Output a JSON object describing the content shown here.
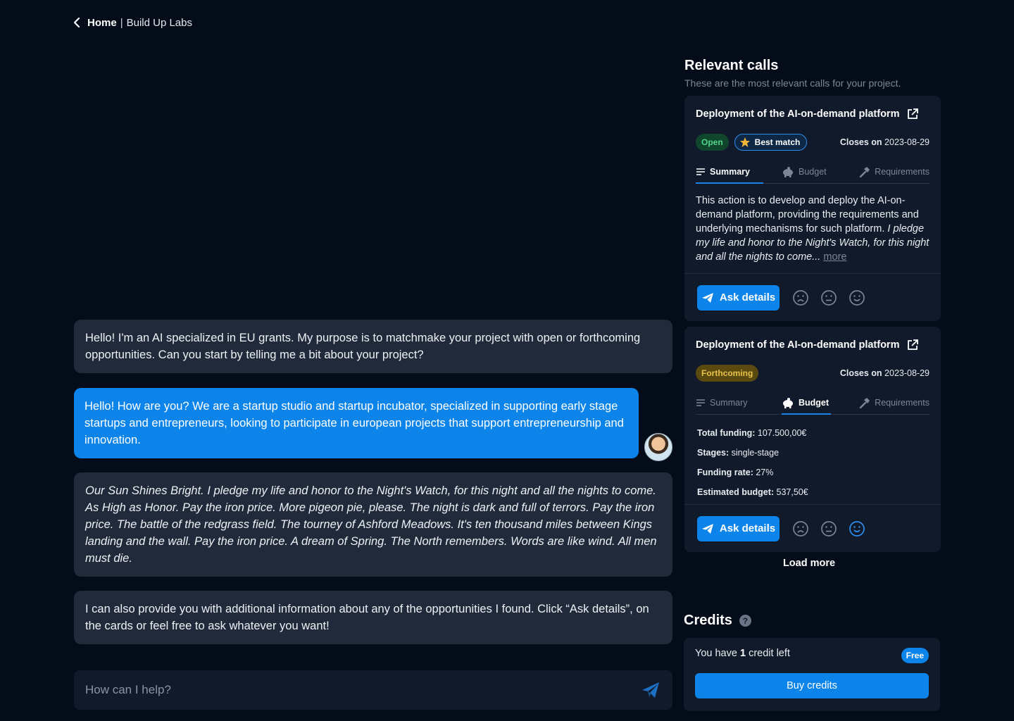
{
  "breadcrumb": {
    "home": "Home",
    "separator": "|",
    "current": "Build Up Labs"
  },
  "chat": {
    "messages": [
      {
        "role": "assistant",
        "text": "Hello! I'm an AI specialized in EU grants. My purpose is to matchmake your project with open or forthcoming opportunities. Can you start by telling me a bit about your project?"
      },
      {
        "role": "user",
        "text": "Hello! How are you? We are a startup studio and startup incubator, specialized in supporting early stage startups and entrepreneurs, looking to participate in european projects that support entrepreneurship and innovation."
      },
      {
        "role": "assistant",
        "text": "Our Sun Shines Bright. I pledge my life and honor to the Night's Watch, for this night and all the nights to come. As High as Honor. Pay the iron price. More pigeon pie, please. The night is dark and full of terrors. Pay the iron price. The battle of the redgrass field. The tourney of Ashford Meadows. It's ten thousand miles between Kings landing and the wall. Pay the iron price. A dream of Spring. The North remembers. Words are like wind. All men must die."
      },
      {
        "role": "assistant",
        "text": "I can also provide you with additional information about any of the opportunities I found. Click “Ask details”, on the cards or feel free to ask whatever you want!"
      }
    ],
    "input_placeholder": "How can I help?"
  },
  "relevant_calls": {
    "title": "Relevant calls",
    "subtitle": "These are the most relevant calls for your project.",
    "cards": [
      {
        "title": "Deployment of the AI-on-demand platform",
        "status": "Open",
        "best_match": "Best match",
        "closes_label": "Closes on",
        "closes_date": "2023-08-29",
        "tabs": [
          "Summary",
          "Budget",
          "Requirements"
        ],
        "active_tab": "Summary",
        "summary_text": "This action is to develop and deploy the AI-on-demand platform, providing the requirements and underlying mechanisms for such platform. ",
        "summary_italic": "I pledge my life and honor to the Night's Watch, for this night and all the nights to come...",
        "more": "more",
        "ask_label": "Ask details"
      },
      {
        "title": "Deployment of the AI-on-demand platform",
        "status": "Forthcoming",
        "closes_label": "Closes on",
        "closes_date": "2023-08-29",
        "tabs": [
          "Summary",
          "Budget",
          "Requirements"
        ],
        "active_tab": "Budget",
        "budget": {
          "total_funding_label": "Total funding:",
          "total_funding": "107.500,00€",
          "stages_label": "Stages:",
          "stages": "single-stage",
          "funding_rate_label": "Funding rate:",
          "funding_rate": "27%",
          "estimated_budget_label": "Estimated budget:",
          "estimated_budget": "537,50€"
        },
        "ask_label": "Ask details"
      }
    ],
    "load_more": "Load more"
  },
  "credits": {
    "title": "Credits",
    "help": "?",
    "prefix": "You have",
    "count": "1",
    "suffix": "credit left",
    "plan": "Free",
    "buy_label": "Buy credits"
  },
  "colors": {
    "background": "#030c18",
    "surface": "#111a2a",
    "bubble": "#202a3b",
    "accent": "#0c84ea",
    "hover_icon": "#2f8fef"
  }
}
